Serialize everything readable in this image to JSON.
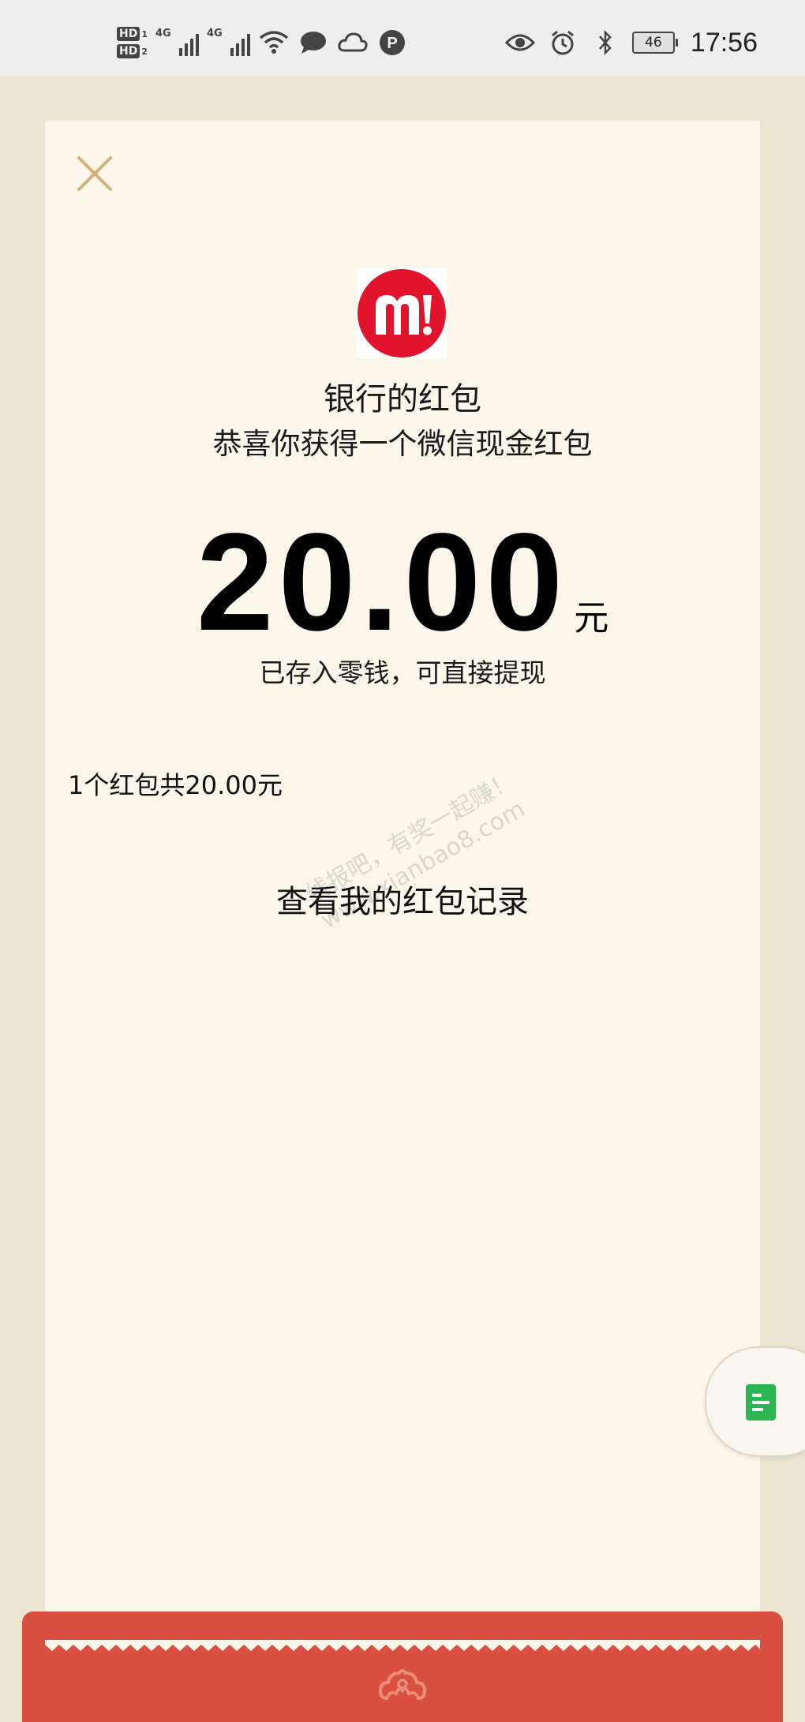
{
  "status_bar": {
    "hd1": "HD",
    "hd1_sub": "1",
    "hd2": "HD",
    "hd2_sub": "2",
    "net1": "4G",
    "net2": "4G",
    "battery_level": "46",
    "time": "17:56",
    "icons": [
      "signal-icon",
      "signal-icon",
      "wifi-icon",
      "chat-bubble-icon",
      "cloud-icon",
      "p-badge-icon",
      "eye-icon",
      "alarm-icon",
      "bluetooth-icon",
      "battery-icon"
    ]
  },
  "card": {
    "close_icon": "close-icon",
    "logo_icon": "bank-m-logo",
    "sender": "银行的红包",
    "greeting": "恭喜你获得一个微信现金红包",
    "amount": "20.00",
    "unit": "元",
    "saved_note": "已存入零钱，可直接提现",
    "summary": "1个红包共20.00元",
    "records_link": "查看我的红包记录"
  },
  "watermark": {
    "line1": "线报吧，有奖一起赚！",
    "line2": "www.xianbao8.com"
  },
  "float_button_icon": "document-icon",
  "footer_icon": "cloud-emblem-icon",
  "colors": {
    "background": "#ebe4d1",
    "card": "#fbf7ea",
    "footer_red": "#d95041",
    "close_tan": "#d4b07a",
    "logo_red": "#e2142d",
    "float_green": "#2bb553"
  }
}
